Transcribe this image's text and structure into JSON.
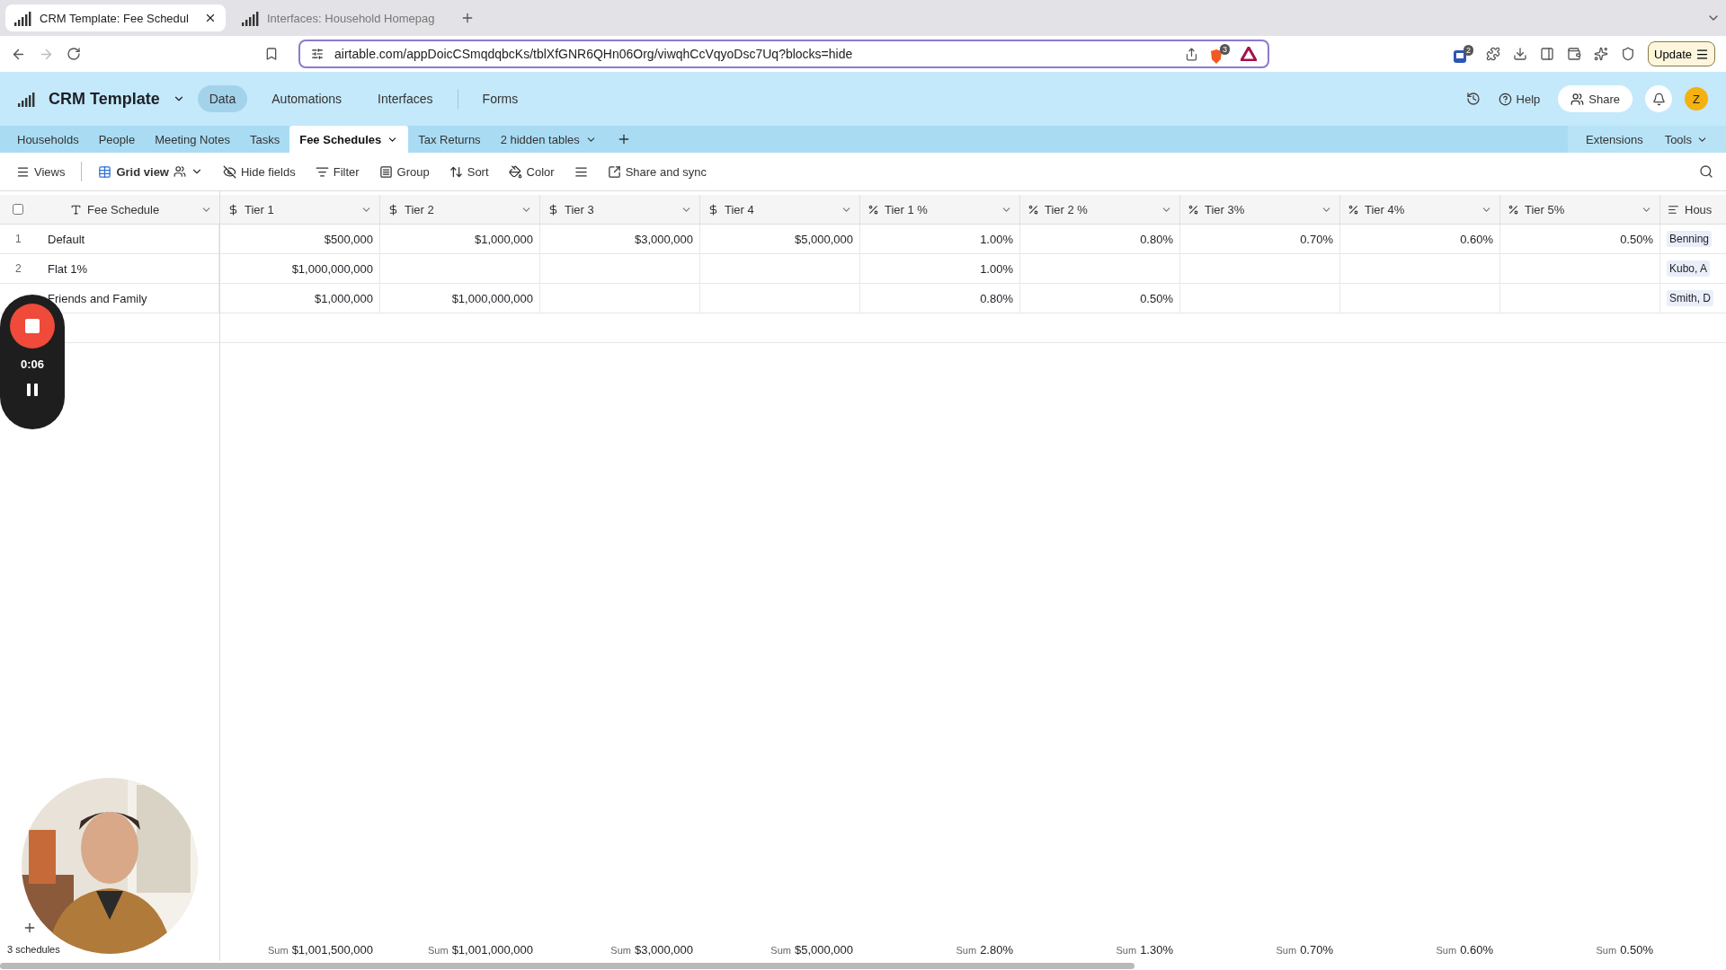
{
  "browser": {
    "tabs": [
      {
        "title": "CRM Template: Fee Schedul",
        "selected": true
      },
      {
        "title": "Interfaces: Household Homepag",
        "selected": false
      }
    ],
    "url": "airtable.com/appDoicCSmqdqbcKs/tblXfGNR6QHn06Org/viwqhCcVqyoDsc7Uq?blocks=hide",
    "shield_badge": "3",
    "extension_badge": "2",
    "update_button": "Update"
  },
  "app": {
    "base_name": "CRM Template",
    "nav": [
      {
        "label": "Data",
        "selected": true
      },
      {
        "label": "Automations",
        "selected": false
      },
      {
        "label": "Interfaces",
        "selected": false
      },
      {
        "label": "Forms",
        "selected": false
      }
    ],
    "help": "Help",
    "share": "Share",
    "avatar": "Z"
  },
  "tables": [
    {
      "label": "Households",
      "selected": false
    },
    {
      "label": "People",
      "selected": false
    },
    {
      "label": "Meeting Notes",
      "selected": false
    },
    {
      "label": "Tasks",
      "selected": false
    },
    {
      "label": "Fee Schedules",
      "selected": true
    },
    {
      "label": "Tax Returns",
      "selected": false
    },
    {
      "label": "2 hidden tables",
      "selected": false
    }
  ],
  "table_tools": [
    "Extensions",
    "Tools"
  ],
  "toolbar": {
    "views": "Views",
    "view_name": "Grid view",
    "buttons": [
      {
        "kind": "hide",
        "label": "Hide fields"
      },
      {
        "kind": "filter",
        "label": "Filter"
      },
      {
        "kind": "group",
        "label": "Group"
      },
      {
        "kind": "sort",
        "label": "Sort"
      },
      {
        "kind": "color",
        "label": "Color"
      },
      {
        "kind": "row_height"
      },
      {
        "kind": "share",
        "label": "Share and sync"
      }
    ]
  },
  "grid": {
    "select_all_checked": false,
    "columns": [
      {
        "label": "Fee Schedule",
        "kind": "text"
      },
      {
        "label": "Tier 1",
        "kind": "currency"
      },
      {
        "label": "Tier 2",
        "kind": "currency"
      },
      {
        "label": "Tier 3",
        "kind": "currency"
      },
      {
        "label": "Tier 4",
        "kind": "currency"
      },
      {
        "label": "Tier 1 %",
        "kind": "percent"
      },
      {
        "label": "Tier 2 %",
        "kind": "percent"
      },
      {
        "label": "Tier 3%",
        "kind": "percent"
      },
      {
        "label": "Tier 4%",
        "kind": "percent"
      },
      {
        "label": "Tier 5%",
        "kind": "percent"
      },
      {
        "label": "Hous",
        "kind": "link"
      }
    ],
    "rows": [
      {
        "number": "1",
        "cells": [
          "Default",
          "$500,000",
          "$1,000,000",
          "$3,000,000",
          "$5,000,000",
          "1.00%",
          "0.80%",
          "0.70%",
          "0.60%",
          "0.50%",
          "Benning"
        ]
      },
      {
        "number": "2",
        "cells": [
          "Flat 1%",
          "$1,000,000,000",
          null,
          null,
          null,
          "1.00%",
          null,
          null,
          null,
          null,
          "Kubo, A"
        ]
      },
      {
        "cells": [
          "Friends and Family",
          "$1,000,000",
          "$1,000,000,000",
          null,
          null,
          "0.80%",
          "0.50%",
          null,
          null,
          null,
          "Smith, D"
        ]
      }
    ],
    "footer": {
      "count": "3 schedules",
      "sums": [
        {
          "label": "Sum",
          "value": "$1,001,500,000"
        },
        {
          "label": "Sum",
          "value": "$1,001,000,000"
        },
        {
          "label": "Sum",
          "value": "$3,000,000"
        },
        {
          "label": "Sum",
          "value": "$5,000,000"
        },
        {
          "label": "Sum",
          "value": "2.80%"
        },
        {
          "label": "Sum",
          "value": "1.30%"
        },
        {
          "label": "Sum",
          "value": "0.70%"
        },
        {
          "label": "Sum",
          "value": "0.60%"
        },
        {
          "label": "Sum",
          "value": "0.50%"
        }
      ]
    }
  },
  "recorder": {
    "time": "0:06"
  }
}
